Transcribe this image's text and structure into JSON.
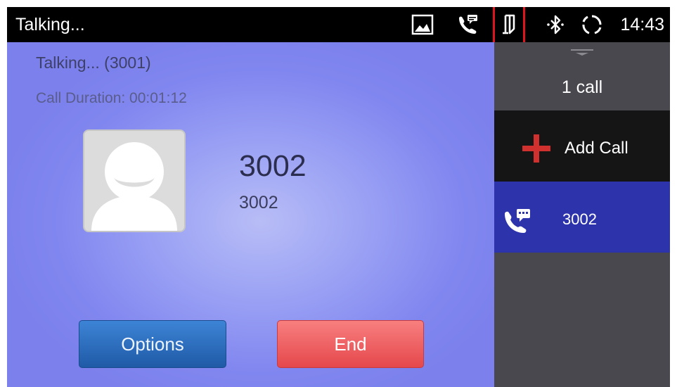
{
  "status_bar": {
    "title": "Talking...",
    "time": "14:43",
    "icons": [
      "image-icon",
      "call-voicemail-icon",
      "handset-icon",
      "bluetooth-icon",
      "sync-icon"
    ]
  },
  "call": {
    "status": "Talking... (3001)",
    "duration": "Call Duration: 00:01:12",
    "caller_name": "3002",
    "caller_number": "3002"
  },
  "buttons": {
    "options": "Options",
    "end": "End"
  },
  "side_panel": {
    "call_count": "1 call",
    "add_call": "Add Call",
    "calls": [
      {
        "number": "3002",
        "icon": "call-message-icon"
      }
    ]
  },
  "colors": {
    "main_background": "#8187ef",
    "options_button": "#2a6cc0",
    "end_button": "#ef5f62",
    "active_call": "#2d33ab",
    "add_call_plus": "#d0312e",
    "highlight": "#e0141c"
  }
}
